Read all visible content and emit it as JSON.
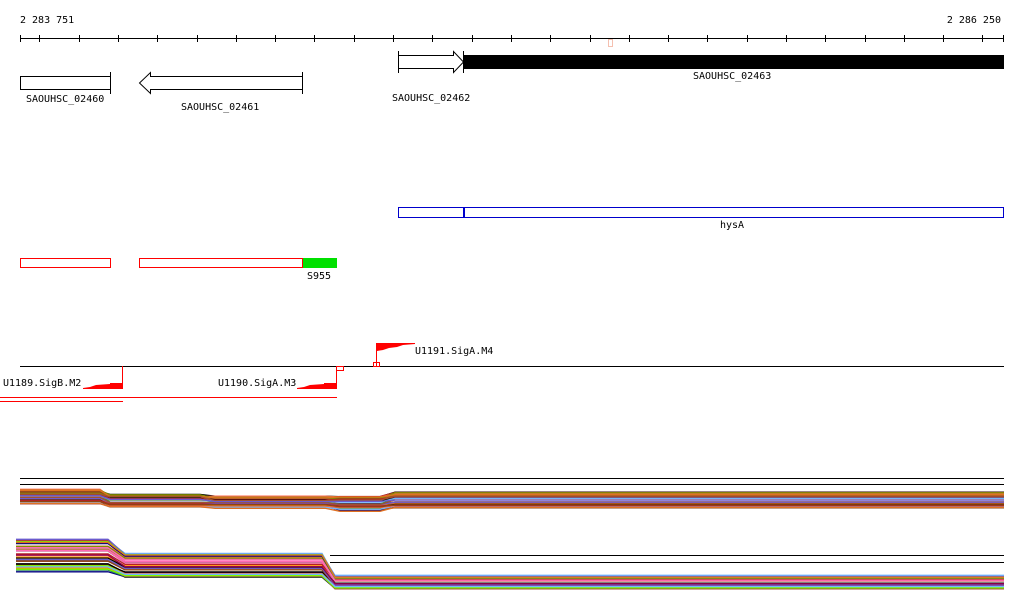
{
  "ruler": {
    "start_label": "2 283 751",
    "end_label": "2 286 250"
  },
  "genes": [
    {
      "name": "SAOUHSC_02460",
      "strand": "none"
    },
    {
      "name": "SAOUHSC_02461",
      "strand": "reverse"
    },
    {
      "name": "SAOUHSC_02462",
      "strand": "forward"
    },
    {
      "name": "SAOUHSC_02463",
      "strand": "forward"
    }
  ],
  "operon": {
    "name": "hysA"
  },
  "rna_features": {
    "name": "S955"
  },
  "promoters": [
    {
      "name": "U1189.SigB.M2",
      "strand": "reverse"
    },
    {
      "name": "U1190.SigA.M3",
      "strand": "reverse"
    },
    {
      "name": "U1191.SigA.M4",
      "strand": "forward"
    }
  ],
  "colors": {
    "promoter": "#ff0000",
    "srna": "#00e000",
    "operon": "#0000cc",
    "feature": "#ff0000"
  },
  "expression_palette": [
    "#ff6a4d",
    "#e07020",
    "#7f8f00",
    "#6fb6ff",
    "#99004c",
    "#7cfc00",
    "#c8a000",
    "#8b4513",
    "#ff69b4",
    "#000080",
    "#a0522d",
    "#ff8c00",
    "#6a5acd",
    "#2e8b57",
    "#b22222"
  ]
}
